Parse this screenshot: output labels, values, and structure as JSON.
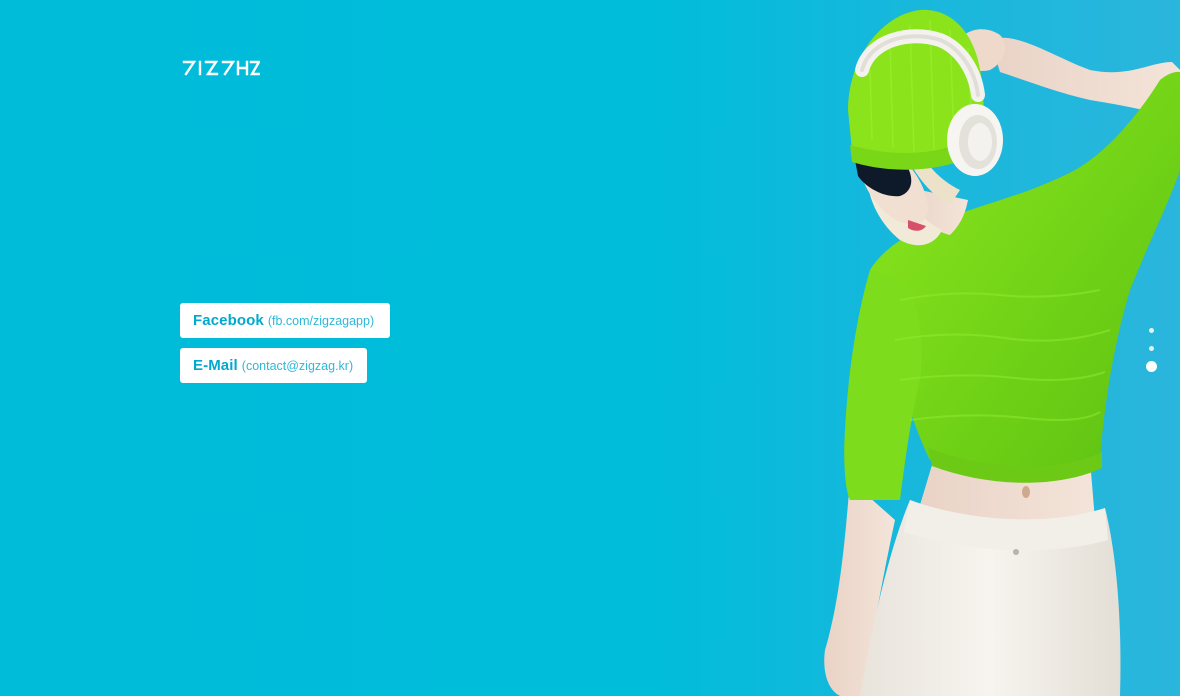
{
  "brand": {
    "logo_text": "ZIGZAG",
    "logo_icon": "zigzag-wordmark"
  },
  "contacts": [
    {
      "label": "Facebook",
      "detail": "(fb.com/zigzagapp)"
    },
    {
      "label": "E-Mail",
      "detail": "(contact@zigzag.kr)"
    }
  ],
  "hero": {
    "image": "model-with-headphones-photo"
  },
  "pager": {
    "count": 3,
    "active_index": 2
  },
  "colors": {
    "background": "#00bcd9",
    "button_text": "#00a9cd",
    "button_background": "#ffffff",
    "sweater": "#7fe11a",
    "beanie": "#8ce61c"
  }
}
